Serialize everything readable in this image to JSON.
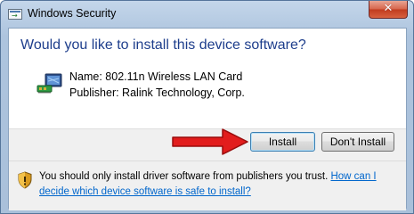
{
  "window": {
    "title": "Windows Security",
    "close_symbol": "✕"
  },
  "dialog": {
    "heading": "Would you like to install this device software?",
    "device_name": "Name: 802.11n Wireless LAN Card",
    "publisher": "Publisher: Ralink Technology, Corp.",
    "buttons": {
      "install": "Install",
      "dont_install": "Don't Install"
    },
    "footer": {
      "text": "You should only install driver software from publishers you trust. ",
      "link": "How can I decide which device software is safe to install?"
    }
  },
  "icons": {
    "title": "security-app-icon",
    "device": "network-adapter-icon",
    "footer": "security-shield-icon",
    "pointer": "red-arrow-icon"
  },
  "colors": {
    "heading": "#1e3e8c",
    "link": "#0066cc",
    "arrow": "#e21d1d"
  }
}
